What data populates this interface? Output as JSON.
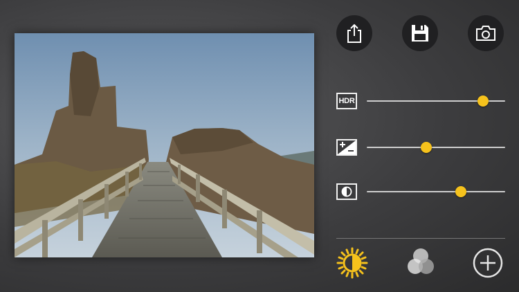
{
  "photo": {
    "description_icon": "castle-ruin-photo"
  },
  "toolbar": {
    "share_icon": "share-icon",
    "save_icon": "floppy-disk-icon",
    "camera_icon": "camera-icon"
  },
  "sliders": [
    {
      "label": "HDR",
      "value": 0.84,
      "icon": "hdr-icon"
    },
    {
      "label": "",
      "value": 0.43,
      "icon": "exposure-icon"
    },
    {
      "label": "",
      "value": 0.68,
      "icon": "contrast-icon"
    }
  ],
  "bottom": {
    "brightness_icon": "sun-icon",
    "blend_icon": "color-circles-icon",
    "add_icon": "plus-icon"
  },
  "colors": {
    "accent": "#f6c21c",
    "background": "#3d3d3f",
    "button_bg": "#202022"
  }
}
